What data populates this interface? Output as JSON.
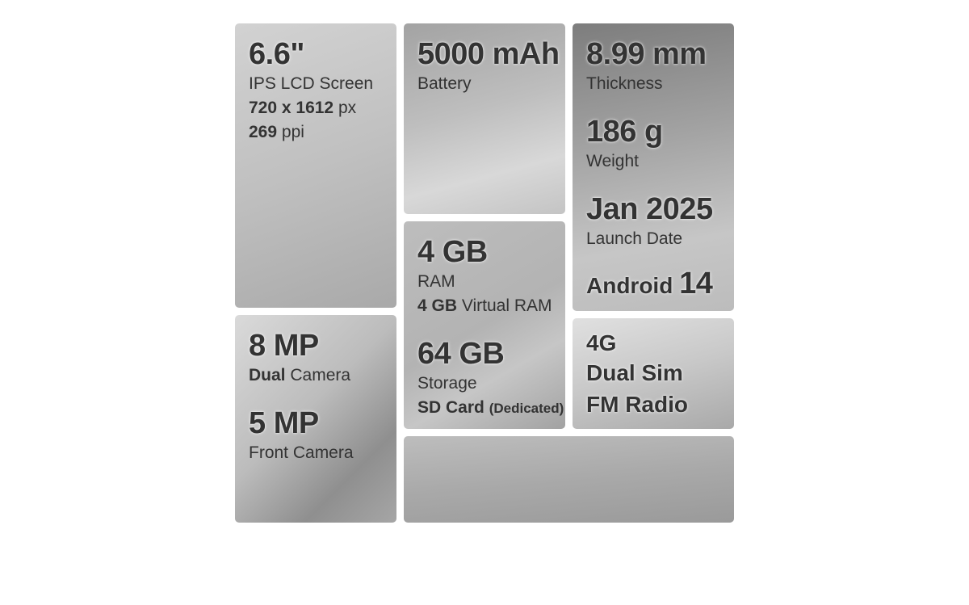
{
  "screen": {
    "size": "6.6\"",
    "type": "IPS LCD Screen",
    "resolution_value": "720 x 1612",
    "resolution_unit": "px",
    "density_value": "269",
    "density_unit": "ppi"
  },
  "camera": {
    "main_value": "8 MP",
    "main_qualifier": "Dual",
    "main_label": "Camera",
    "front_value": "5 MP",
    "front_label": "Front Camera"
  },
  "battery": {
    "value": "5000 mAh",
    "label": "Battery"
  },
  "memory": {
    "ram_value": "4 GB",
    "ram_label": "RAM",
    "virtual_value": "4 GB",
    "virtual_label": "Virtual RAM",
    "storage_value": "64 GB",
    "storage_label": "Storage",
    "sd_label": "SD Card",
    "sd_qualifier": "(Dedicated)"
  },
  "body": {
    "thickness_value": "8.99 mm",
    "thickness_label": "Thickness",
    "weight_value": "186 g",
    "weight_label": "Weight",
    "launch_value": "Jan 2025",
    "launch_label": "Launch Date",
    "os_name": "Android",
    "os_version": "14"
  },
  "network": {
    "generation": "4G",
    "sim": "Dual Sim",
    "radio": "FM Radio"
  }
}
